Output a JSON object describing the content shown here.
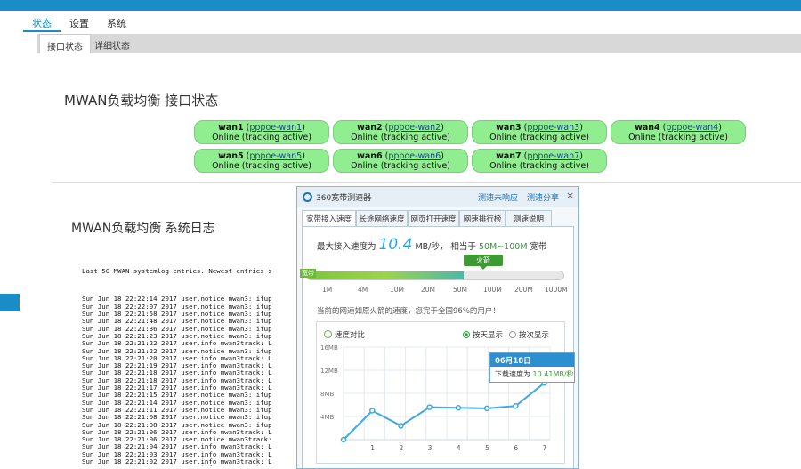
{
  "nav": {
    "items": [
      {
        "label": "状态",
        "active": true
      },
      {
        "label": "设置",
        "active": false
      },
      {
        "label": "系统",
        "active": false
      }
    ]
  },
  "subtabs": [
    {
      "label": "接口状态",
      "active": true
    },
    {
      "label": "详细状态",
      "active": false
    }
  ],
  "interface_section": {
    "title": "MWAN负载均衡 接口状态",
    "wans": [
      {
        "name": "wan1",
        "link": "pppoe-wan1",
        "status": "Online (tracking active)"
      },
      {
        "name": "wan2",
        "link": "pppoe-wan2",
        "status": "Online (tracking active)"
      },
      {
        "name": "wan3",
        "link": "pppoe-wan3",
        "status": "Online (tracking active)"
      },
      {
        "name": "wan4",
        "link": "pppoe-wan4",
        "status": "Online (tracking active)"
      },
      {
        "name": "wan5",
        "link": "pppoe-wan5",
        "status": "Online (tracking active)"
      },
      {
        "name": "wan6",
        "link": "pppoe-wan6",
        "status": "Online (tracking active)"
      },
      {
        "name": "wan7",
        "link": "pppoe-wan7",
        "status": "Online (tracking active)"
      }
    ]
  },
  "log_section": {
    "title": "MWAN负载均衡 系统日志",
    "header": "Last 50 MWAN systemlog entries. Newest entries s",
    "lines": [
      "Sun Jun 18 22:22:14 2017 user.notice mwan3: ifup",
      "Sun Jun 18 22:22:07 2017 user.notice mwan3: ifup",
      "Sun Jun 18 22:21:58 2017 user.notice mwan3: ifup",
      "Sun Jun 18 22:21:48 2017 user.notice mwan3: ifup",
      "Sun Jun 18 22:21:36 2017 user.notice mwan3: ifup",
      "Sun Jun 18 22:21:23 2017 user.notice mwan3: ifup",
      "Sun Jun 18 22:21:22 2017 user.info mwan3track: L",
      "Sun Jun 18 22:21:22 2017 user.notice mwan3: ifup",
      "Sun Jun 18 22:21:20 2017 user.info mwan3track: L",
      "Sun Jun 18 22:21:19 2017 user.info mwan3track: L",
      "Sun Jun 18 22:21:18 2017 user.info mwan3track: L",
      "Sun Jun 18 22:21:18 2017 user.info mwan3track: L",
      "Sun Jun 18 22:21:17 2017 user.info mwan3track: L",
      "Sun Jun 18 22:21:15 2017 user.notice mwan3: ifup",
      "Sun Jun 18 22:21:14 2017 user.notice mwan3: ifup",
      "Sun Jun 18 22:21:11 2017 user.notice mwan3: ifup",
      "Sun Jun 18 22:21:08 2017 user.notice mwan3: ifup",
      "Sun Jun 18 22:21:08 2017 user.notice mwan3: ifup",
      "Sun Jun 18 22:21:06 2017 user.info mwan3track: L",
      "Sun Jun 18 22:21:06 2017 user.notice mwan3track:",
      "Sun Jun 18 22:21:04 2017 user.info mwan3track: L",
      "Sun Jun 18 22:21:03 2017 user.info mwan3track: L",
      "Sun Jun 18 22:21:02 2017 user.info mwan3track: L",
      "Sun Jun 18 22:21:02 2017 user.info mwan3track: L",
      "Sun Jun 18 22:21:01 2017 user.info mwan3track: L"
    ]
  },
  "popup": {
    "title": "360宽带测速器",
    "link1": "测速未响应",
    "link2": "测速分享",
    "close": "×",
    "tabs": [
      "宽带接入速度",
      "长途网络速度",
      "网页打开速度",
      "网速排行榜",
      "测速说明"
    ],
    "speed_prefix": "最大接入速度为",
    "speed_value": "10.4",
    "speed_unit": "MB/秒，",
    "speed_equiv_prefix": "相当于",
    "speed_equiv": "50M~100M",
    "speed_equiv_suffix": "宽带",
    "badge": "火箭",
    "gauge_label": "宽带",
    "gauge_level": 0.61,
    "ticks": [
      "1M",
      "4M",
      "10M",
      "20M",
      "50M",
      "100M",
      "200M",
      "1000M"
    ],
    "compare_text": "当前的网速如原火箭的速度，您完于全国96%的用户！",
    "chart_title": "速度对比",
    "radio_on": "按天显示",
    "radio_off": "按次显示",
    "tooltip_date": "06月18日",
    "tooltip_label": "下载速度为",
    "tooltip_value": "10.41MB/秒"
  },
  "chart_data": {
    "type": "line",
    "x": [
      "1",
      "2",
      "3",
      "4",
      "5",
      "6",
      "7"
    ],
    "values": [
      5.0,
      2.4,
      5.6,
      5.5,
      5.4,
      5.8,
      9.8
    ],
    "y_ticks": [
      "4MB",
      "8MB",
      "12MB",
      "16MB"
    ],
    "ylim": [
      0,
      16
    ],
    "colors": {
      "line": "#43a9dc",
      "grid": "#e3eaf0",
      "point_fill": "#ffffff"
    }
  }
}
